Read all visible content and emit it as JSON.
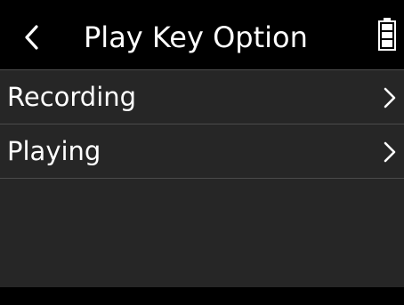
{
  "header": {
    "title": "Play Key Option",
    "back_icon": "chevron-left-icon",
    "battery_icon": "battery-icon"
  },
  "menu": {
    "items": [
      {
        "label": "Recording",
        "icon": "chevron-right-icon"
      },
      {
        "label": "Playing",
        "icon": "chevron-right-icon"
      }
    ]
  },
  "colors": {
    "header_bg": "#000000",
    "menu_bg": "#262626",
    "divider": "#4b4b4b",
    "text": "#ffffff"
  }
}
